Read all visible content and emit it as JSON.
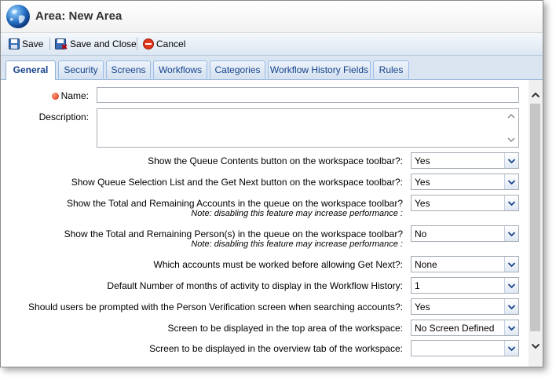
{
  "window": {
    "title": "Area: New Area"
  },
  "toolbar": {
    "save": "Save",
    "save_close": "Save and Close",
    "cancel": "Cancel"
  },
  "tabs": [
    "General",
    "Security",
    "Screens",
    "Workflows",
    "Categories",
    "Workflow History Fields",
    "Rules"
  ],
  "active_tab": "General",
  "form": {
    "name_label": "Name:",
    "name_value": "",
    "description_label": "Description:",
    "description_value": "",
    "fields": [
      {
        "label": "Show the Queue Contents button on the workspace toolbar?:",
        "note": "",
        "value": "Yes"
      },
      {
        "label": "Show Queue Selection List and the Get Next button on the workspace toolbar?:",
        "note": "",
        "value": "Yes"
      },
      {
        "label": "Show the Total and Remaining Accounts in the queue on the workspace toolbar?",
        "note": "Note: disabling this feature may increase performance",
        "value": "Yes"
      },
      {
        "label": "Show the Total and Remaining Person(s) in the queue on the workspace toolbar?",
        "note": "Note: disabling this feature may increase performance",
        "value": "No"
      },
      {
        "label": "Which accounts must be worked before allowing Get Next?:",
        "note": "",
        "value": "None"
      },
      {
        "label": "Default Number of months of activity to display in the Workflow History:",
        "note": "",
        "value": "1"
      },
      {
        "label": "Should users be prompted with the Person Verification screen when searching accounts?:",
        "note": "",
        "value": "Yes"
      },
      {
        "label": "Screen to be displayed in the top area of the workspace:",
        "note": "",
        "value": "No Screen Defined"
      },
      {
        "label": "Screen to be displayed in the overview tab of the workspace:",
        "note": "",
        "value": ""
      }
    ]
  },
  "colors": {
    "tab_text": "#15428b",
    "required": "#d42a0a",
    "accent_border": "#99bbe8"
  }
}
